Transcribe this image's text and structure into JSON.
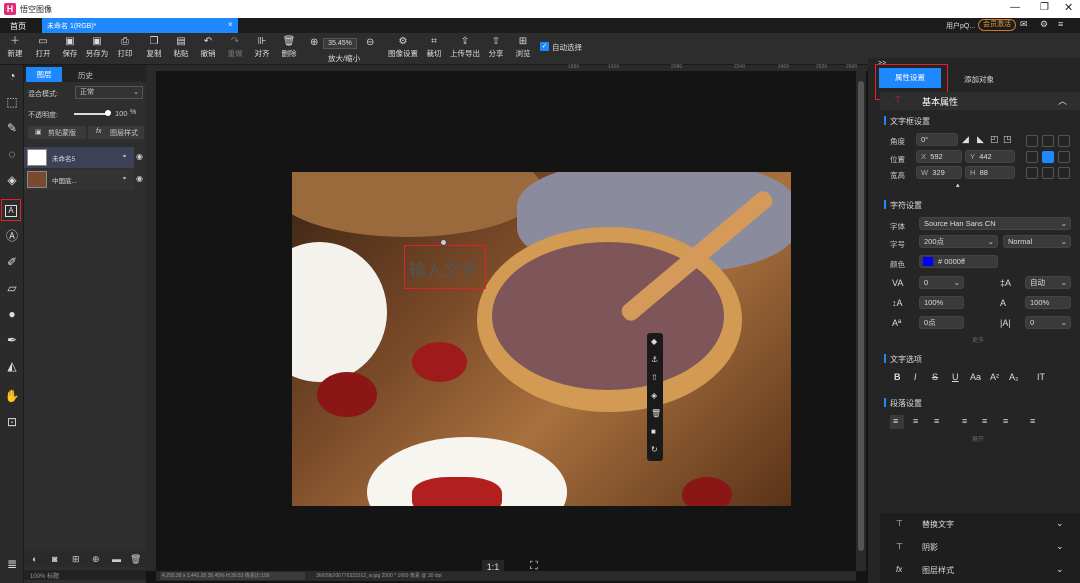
{
  "app": {
    "title": "悟空图像",
    "logo": "H"
  },
  "tabs": {
    "home": "首页",
    "doc": "未命名 1(RGB)*",
    "close": "×"
  },
  "user": {
    "name": "用户pQ...",
    "member": "会员激活"
  },
  "toolbar": {
    "new": "新建",
    "open": "打开",
    "save": "保存",
    "save_as": "另存为",
    "print": "打印",
    "copy": "复制",
    "paste": "粘贴",
    "undo": "撤销",
    "redo": "重做",
    "align": "对齐",
    "delete": "删除",
    "zoom": "35.45%",
    "zoom_label": "放大/缩小",
    "image_settings": "图像设置",
    "crop": "裁切",
    "upload": "上传导出",
    "share": "分享",
    "browse": "浏览",
    "auto_select": "自动选择"
  },
  "layers_panel": {
    "tab_layers": "图层",
    "tab_history": "历史",
    "blend_label": "混合模式:",
    "blend_value": "正常",
    "opacity_label": "不透明度:",
    "opacity_value": "100",
    "opacity_unit": "%",
    "clip_mask": "剪贴蒙版",
    "layer_style": "图层样式",
    "layers": [
      {
        "name": "未命名5"
      },
      {
        "name": "中国底..."
      }
    ],
    "footer": "100%  标题"
  },
  "canvas": {
    "text_placeholder": "输入文字",
    "ratio_btn": "1:1",
    "status": "4,292.28 x 1,441.28 35.45% H:30.53 像素比:100",
    "status2": "36609b206776333312_w.jpg 2500 * 1669 像素 @ 30 dpi"
  },
  "ruler": [
    "1880",
    "1920",
    "2080",
    "2240",
    "2400",
    "2520",
    "2600"
  ],
  "right_panel": {
    "collapse": ">>",
    "tab_props": "属性设置",
    "tab_add": "添加对象",
    "section_basic": "基本属性",
    "textbox_settings": "文字框设置",
    "angle_label": "角度",
    "angle": "0°",
    "pos_label": "位置",
    "x_label": "X",
    "x": "592",
    "y_label": "Y",
    "y": "442",
    "size_label": "宽高",
    "w_label": "W",
    "w": "329",
    "h_label": "H",
    "h": "88",
    "char_settings": "字符设置",
    "font_label": "字体",
    "font": "Source Han Sans CN",
    "size_lbl": "字号",
    "size": "200点",
    "weight": "Normal",
    "color_label": "颜色",
    "color_value": "0000ff",
    "color_hex": "#0000ff",
    "tracking": "0",
    "leading": "自动",
    "vscale": "100%",
    "hscale": "100%",
    "baseline": "0点",
    "kerning": "0",
    "more": "更多",
    "text_options": "文字选项",
    "para_settings": "段落设置",
    "unfold": "展开",
    "replace_text": "替换文字",
    "shadow": "阴影",
    "layer_style": "图层样式"
  },
  "colors": {
    "accent": "#1e88ff",
    "highlight": "#e0202a"
  }
}
